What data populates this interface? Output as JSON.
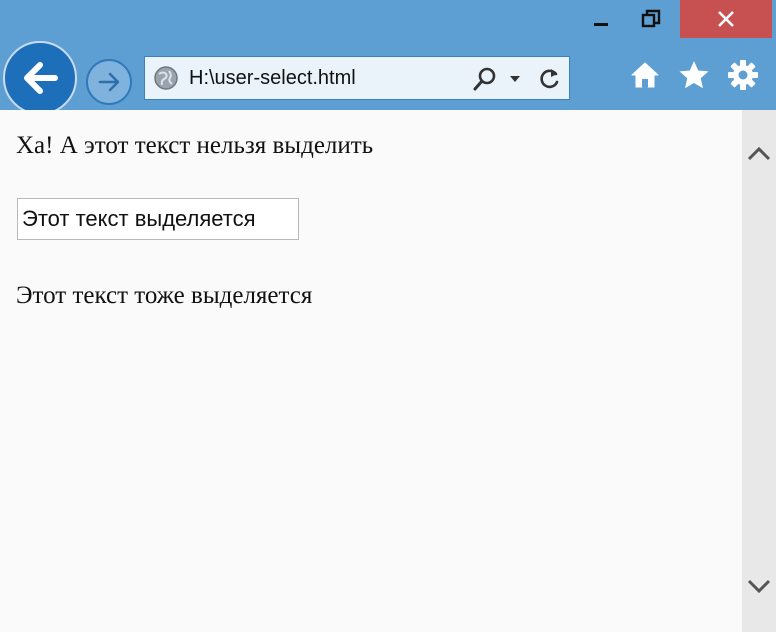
{
  "browser": {
    "address": "H:\\user-select.html",
    "accent_color": "#5e9fd3",
    "close_color": "#c75050",
    "icons": {
      "back": "back-arrow-icon",
      "forward": "forward-arrow-icon",
      "site": "globe-icon",
      "search": "search-icon",
      "dropdown": "chevron-down-icon",
      "refresh": "refresh-icon",
      "home": "home-icon",
      "favorites": "star-icon",
      "settings": "gear-icon",
      "minimize": "minimize-icon",
      "restore": "restore-icon",
      "close": "close-icon"
    }
  },
  "page": {
    "unselectable_text": "Ха! А этот текст нельзя выделить",
    "input_value": "Этот текст выделяется",
    "selectable_text": "Этот текст тоже выделяется"
  }
}
